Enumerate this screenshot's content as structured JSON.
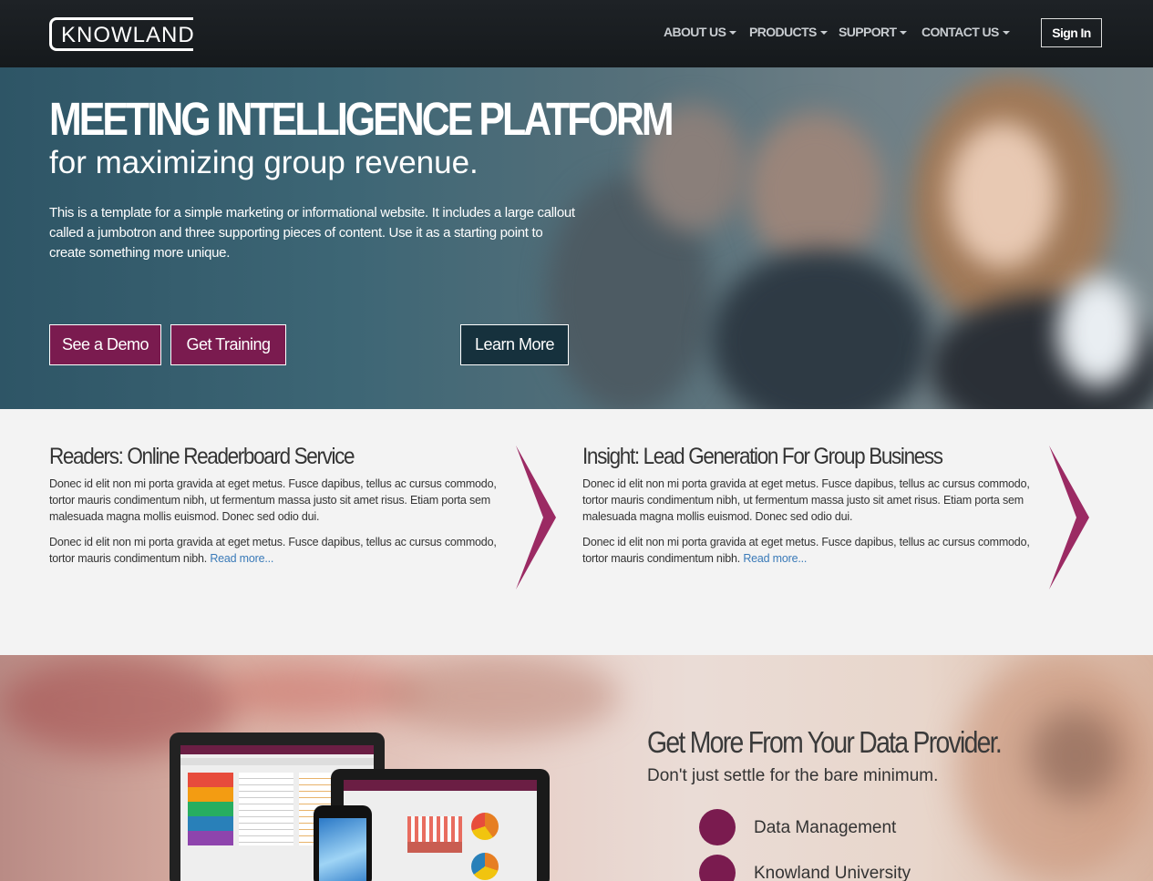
{
  "brand": {
    "logo_text": "KNOWLAND"
  },
  "nav": {
    "items": [
      {
        "label": "ABOUT US"
      },
      {
        "label": "PRODUCTS"
      },
      {
        "label": "SUPPORT"
      },
      {
        "label": "CONTACT US"
      }
    ],
    "signin_label": "Sign In"
  },
  "hero": {
    "title": "MEETING INTELLIGENCE PLATFORM",
    "subtitle": "for maximizing group revenue.",
    "body": "This is a template for a simple marketing or informational website. It includes a large callout called a jumbotron and three supporting pieces of content. Use it as a starting point to create something more unique.",
    "buttons": {
      "demo": "See a Demo",
      "training": "Get Training",
      "learn": "Learn More"
    }
  },
  "features": [
    {
      "title": "Readers: Online Readerboard Service",
      "para1": "Donec id elit non mi porta gravida at eget metus. Fusce dapibus, tellus ac cursus commodo, tortor mauris condimentum nibh, ut fermentum massa justo sit amet risus. Etiam porta sem malesuada magna mollis euismod. Donec sed odio dui.",
      "para2": "Donec id elit non mi porta gravida at eget metus. Fusce dapibus, tellus ac cursus commodo, tortor mauris condimentum nibh.",
      "link": "Read more..."
    },
    {
      "title": "Insight: Lead Generation For Group Business",
      "para1": "Donec id elit non mi porta gravida at eget metus. Fusce dapibus, tellus ac cursus commodo, tortor mauris condimentum nibh, ut fermentum massa justo sit amet risus. Etiam porta sem malesuada magna mollis euismod. Donec sed odio dui.",
      "para2": "Donec id elit non mi porta gravida at eget metus. Fusce dapibus, tellus ac cursus commodo, tortor mauris condimentum nibh.",
      "link": "Read more..."
    }
  ],
  "data_section": {
    "title": "Get More From Your Data Provider.",
    "subtitle": "Don't just settle for the bare minimum.",
    "items": [
      {
        "label": "Data Management"
      },
      {
        "label": "Knowland University"
      }
    ]
  },
  "colors": {
    "accent": "#7a1b4f",
    "chevron": "#9b2a63",
    "link": "#3a7ab8",
    "navbar": "#1a1e21"
  },
  "icons": {
    "caret": "caret-down-icon",
    "chevron": "chevron-right-icon"
  }
}
